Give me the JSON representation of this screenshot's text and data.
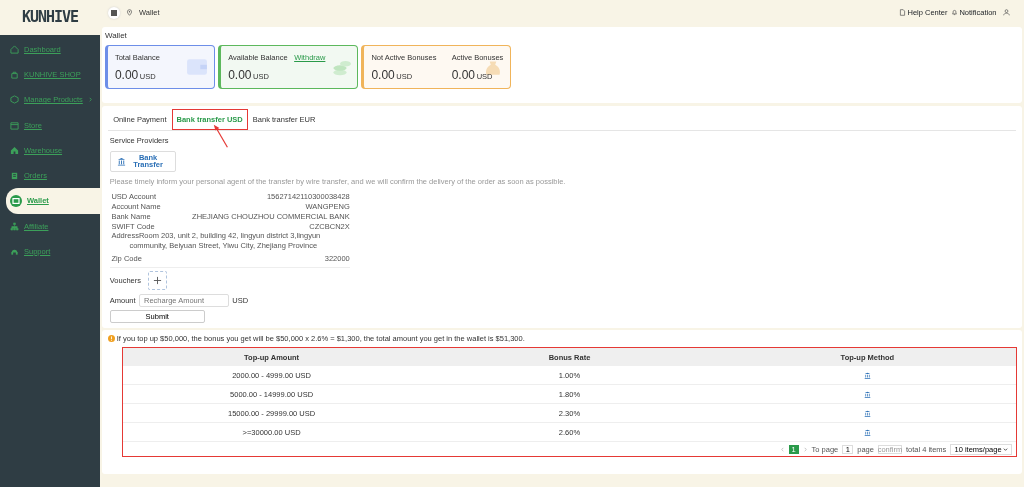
{
  "sidebar": {
    "logo": "KUNHIVE",
    "items": [
      {
        "label": "Dashboard",
        "selected": false,
        "submenu": false
      },
      {
        "label": "KUNHIVE SHOP",
        "selected": false,
        "submenu": false
      },
      {
        "label": "Manage Products",
        "selected": false,
        "submenu": true
      },
      {
        "label": "Store",
        "selected": false,
        "submenu": false
      },
      {
        "label": "Warehouse",
        "selected": false,
        "submenu": false
      },
      {
        "label": "Orders",
        "selected": false,
        "submenu": false
      },
      {
        "label": "Wallet",
        "selected": true,
        "submenu": false
      },
      {
        "label": "Affiliate",
        "selected": false,
        "submenu": false
      },
      {
        "label": "Support",
        "selected": false,
        "submenu": false
      }
    ]
  },
  "header": {
    "breadcrumb": "Wallet",
    "links": [
      {
        "label": "Help Center",
        "kind": "doc"
      },
      {
        "label": "Notification",
        "kind": "bell"
      }
    ]
  },
  "wallet": {
    "title": "Wallet",
    "cards": [
      {
        "color": "#6d8ee8",
        "balances": [
          {
            "label": "Total Balance",
            "amount": "0.00",
            "unit": "USD"
          }
        ]
      },
      {
        "color": "#5cb85c",
        "link": "Withdraw",
        "balances": [
          {
            "label": "Available Balance",
            "amount": "0.00",
            "unit": "USD"
          }
        ]
      },
      {
        "color": "#f0b45a",
        "balances": [
          {
            "label": "Not Active Bonuses",
            "amount": "0.00",
            "unit": "USD"
          },
          {
            "label": "Active Bonuses",
            "amount": "0.00",
            "unit": "USD"
          }
        ]
      }
    ]
  },
  "tabs": [
    {
      "label": "Online Payment",
      "selected": false
    },
    {
      "label": "Bank transfer USD",
      "selected": true
    },
    {
      "label": "Bank transfer EUR",
      "selected": false
    }
  ],
  "service_providers": {
    "label": "Service Providers",
    "provider": "Bank Transfer"
  },
  "notice": "Please timely inform your personal agent of the transfer by wire transfer, and we will confirm the delivery of the order as soon as possible.",
  "details": [
    {
      "label": "USD Account",
      "value": "15627142110300038428"
    },
    {
      "label": "Account Name",
      "value": "WANGPENG"
    },
    {
      "label": "Bank Name",
      "value": "ZHEJIANG CHOUZHOU COMMERCIAL BANK"
    },
    {
      "label": "SWIFT Code",
      "value": "CZCBCN2X"
    },
    {
      "label": "Address",
      "value": "Room 203, unit 2, building 42, lingyun district 3,lingyun community, Beiyuan Street, Yiwu City, Zhejiang Province",
      "kind": "wrap"
    },
    {
      "label": "Zip Code",
      "value": "322000"
    }
  ],
  "form": {
    "vouchers_label": "Vouchers",
    "amount_label": "Amount",
    "amount_placeholder": "Recharge Amount",
    "unit": "USD",
    "submit": "Submit"
  },
  "bonus_info": "If you top up $50,000, the bonus you get will be $50,000 x 2.6% = $1,300, the total amount you get in the wallet is $51,300.",
  "table": {
    "columns": [
      "Top-up Amount",
      "Bonus Rate",
      "Top-up Method"
    ],
    "rows": [
      {
        "amount": "2000.00 - 4999.00 USD",
        "rate": "1.00%"
      },
      {
        "amount": "5000.00 - 14999.00 USD",
        "rate": "1.80%"
      },
      {
        "amount": "15000.00 - 29999.00 USD",
        "rate": "2.30%"
      },
      {
        "amount": ">=30000.00 USD",
        "rate": "2.60%"
      }
    ]
  },
  "pagination": {
    "pages": [
      {
        "label": "1",
        "selected": true
      }
    ],
    "to_page": "To page",
    "page_value": "1",
    "page": "page",
    "confirm": "confirm",
    "total": "total 4 items",
    "per_page": "10 items/page"
  }
}
